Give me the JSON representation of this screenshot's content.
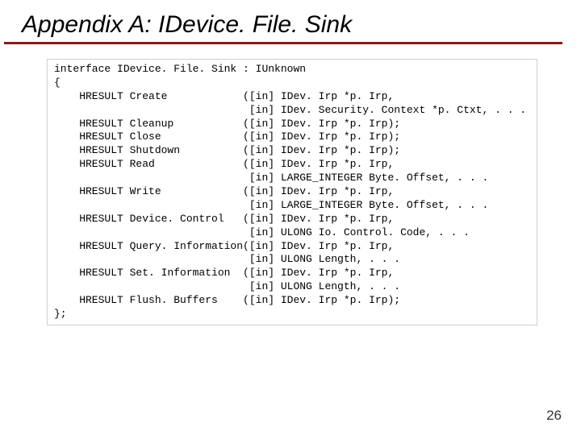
{
  "title": "Appendix A: IDevice. File. Sink",
  "header": "interface IDevice. File. Sink : IUnknown",
  "open": "{",
  "rows": [
    "    HRESULT Create            ([in] IDev. Irp *p. Irp,",
    "                               [in] IDev. Security. Context *p. Ctxt, . . .",
    "    HRESULT Cleanup           ([in] IDev. Irp *p. Irp);",
    "    HRESULT Close             ([in] IDev. Irp *p. Irp);",
    "    HRESULT Shutdown          ([in] IDev. Irp *p. Irp);",
    "    HRESULT Read              ([in] IDev. Irp *p. Irp,",
    "                               [in] LARGE_INTEGER Byte. Offset, . . .",
    "    HRESULT Write             ([in] IDev. Irp *p. Irp,",
    "                               [in] LARGE_INTEGER Byte. Offset, . . .",
    "    HRESULT Device. Control   ([in] IDev. Irp *p. Irp,",
    "                               [in] ULONG Io. Control. Code, . . .",
    "    HRESULT Query. Information([in] IDev. Irp *p. Irp,",
    "                               [in] ULONG Length, . . .",
    "    HRESULT Set. Information  ([in] IDev. Irp *p. Irp,",
    "                               [in] ULONG Length, . . .",
    "    HRESULT Flush. Buffers    ([in] IDev. Irp *p. Irp);"
  ],
  "close": "};",
  "pagenum": "26"
}
